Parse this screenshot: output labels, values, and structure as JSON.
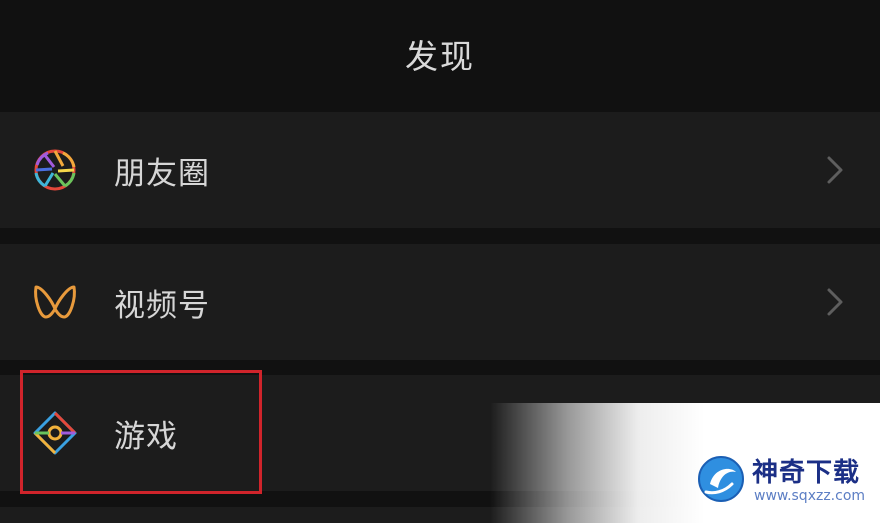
{
  "header": {
    "title": "发现"
  },
  "menu": {
    "items": [
      {
        "label": "朋友圈",
        "icon": "moments-shutter-icon"
      },
      {
        "label": "视频号",
        "icon": "channels-butterfly-icon"
      },
      {
        "label": "游戏",
        "icon": "games-diamond-icon"
      }
    ]
  },
  "watermark": {
    "name": "神奇下载",
    "url": "www.sqxzz.com"
  },
  "colors": {
    "background": "#111111",
    "row": "#1c1c1c",
    "highlight": "#d0242b",
    "text": "#d6d6d6"
  }
}
